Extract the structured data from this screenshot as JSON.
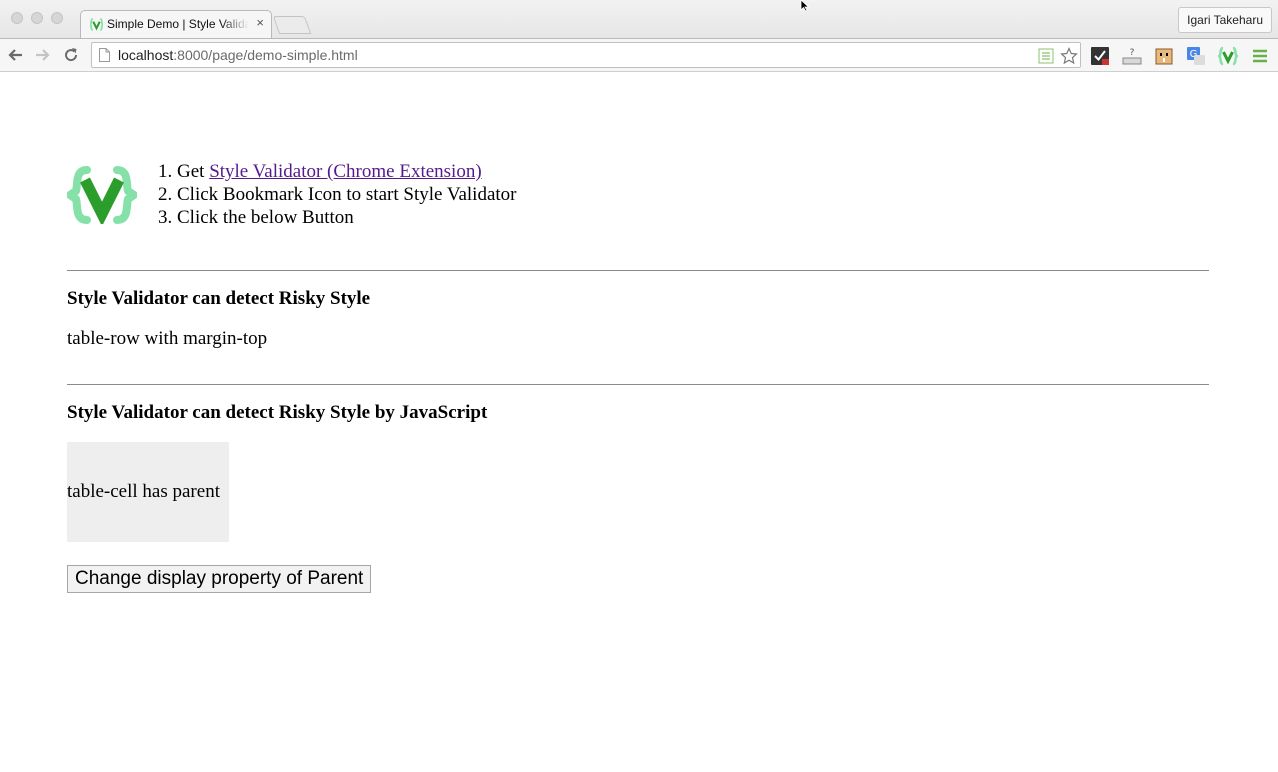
{
  "browser": {
    "tab_title": "Simple Demo | Style Validator",
    "tab_close": "×",
    "profile_name": "Igari Takeharu",
    "url_host": "localhost",
    "url_path": ":8000/page/demo-simple.html"
  },
  "page": {
    "steps": {
      "step1_prefix": "Get ",
      "step1_link": "Style Validator (Chrome Extension)",
      "step2": "Click Bookmark Icon to start Style Validator",
      "step3": "Click the below Button"
    },
    "section1": {
      "heading": "Style Validator can detect Risky Style",
      "text": "table-row with margin-top"
    },
    "section2": {
      "heading": "Style Validator can detect Risky Style by JavaScript",
      "cell_text": "table-cell has parent",
      "button_label": "Change display property of Parent"
    }
  },
  "colors": {
    "logo_light": "#86e1a8",
    "logo_dark": "#2a9d2a",
    "link": "#551a8b",
    "cell_bg": "#eeeeee"
  }
}
